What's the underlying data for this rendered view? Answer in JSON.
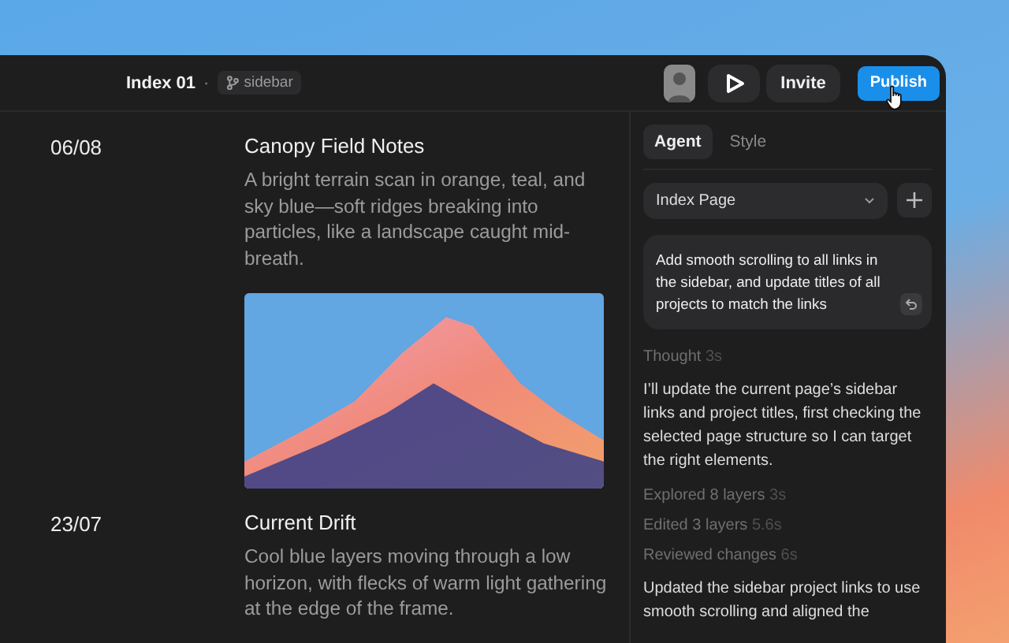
{
  "toolbar": {
    "project": "Index 01",
    "separator": "·",
    "branch": "sidebar",
    "invite": "Invite",
    "publish": "Publish"
  },
  "entries": [
    {
      "date": "06/08",
      "title": "Canopy Field Notes",
      "description": "A bright terrain scan in orange, teal, and sky blue—soft ridges breaking into particles, like a landscape caught mid-breath.",
      "image": true
    },
    {
      "date": "23/07",
      "title": "Current Drift",
      "description": "Cool blue layers moving through a low horizon, with flecks of warm light gathering at the edge of the frame."
    }
  ],
  "panel": {
    "tabs": [
      {
        "label": "Agent",
        "selected": true
      },
      {
        "label": "Style",
        "selected": false
      }
    ],
    "page_select": {
      "value": "Index Page"
    },
    "prompt": "Add smooth scrolling to all links in the sidebar, and update titles of all projects to match the links",
    "log": [
      {
        "kind": "step",
        "label": "Thought",
        "time": "3s"
      },
      {
        "kind": "message",
        "text": "I’ll update the current page’s sidebar links and project titles, first checking the selected page structure so I can target the right elements."
      },
      {
        "kind": "step",
        "label": "Explored 8 layers",
        "time": "3s"
      },
      {
        "kind": "step",
        "label": "Edited 3 layers",
        "time": "5.6s"
      },
      {
        "kind": "step",
        "label": "Reviewed changes",
        "time": "6s"
      },
      {
        "kind": "message",
        "text": "Updated the sidebar project links to use smooth scrolling and aligned the"
      }
    ]
  }
}
